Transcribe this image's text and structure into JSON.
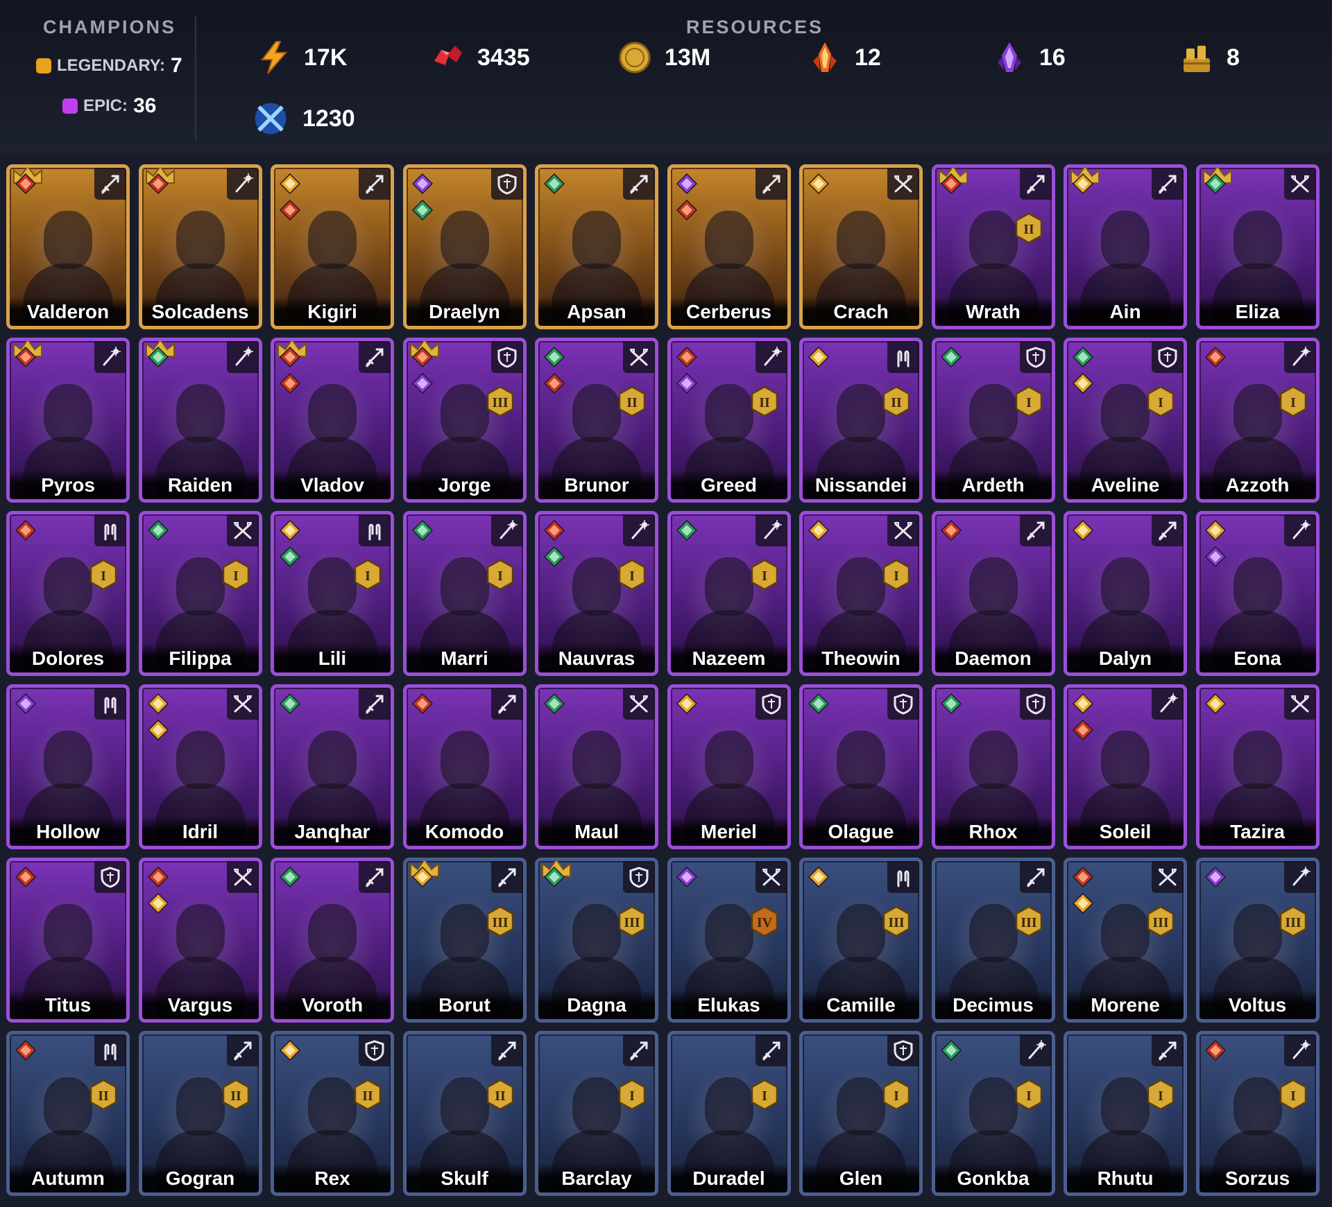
{
  "header": {
    "champions_label": "CHAMPIONS",
    "resources_label": "RESOURCES",
    "legendary": {
      "label": "LEGENDARY:",
      "value": "7",
      "color": "#e8a21c"
    },
    "epic": {
      "label": "EPIC:",
      "value": "36",
      "color": "#c23ff0"
    },
    "resources": [
      {
        "icon": "energy-icon",
        "value": "17K"
      },
      {
        "icon": "ruby-icon",
        "value": "3435"
      },
      {
        "icon": "gold-coin-icon",
        "value": "13M"
      },
      {
        "icon": "fire-shard-icon",
        "value": "12"
      },
      {
        "icon": "void-shard-icon",
        "value": "16"
      },
      {
        "icon": "treasure-icon",
        "value": "8"
      },
      {
        "icon": "arena-token-icon",
        "value": "1230"
      }
    ]
  },
  "champions": [
    {
      "name": "Valderon",
      "rarity": "legendary",
      "role": "attack",
      "affinity": "force",
      "crown": true
    },
    {
      "name": "Solcadens",
      "rarity": "legendary",
      "role": "magic",
      "affinity": "force",
      "crown": true
    },
    {
      "name": "Kigiri",
      "rarity": "legendary",
      "role": "attack",
      "affinity": "magic",
      "affinity2": "force"
    },
    {
      "name": "Draelyn",
      "rarity": "legendary",
      "role": "defense",
      "affinity": "void",
      "affinity2": "spirit"
    },
    {
      "name": "Apsan",
      "rarity": "legendary",
      "role": "attack",
      "affinity": "spirit"
    },
    {
      "name": "Cerberus",
      "rarity": "legendary",
      "role": "attack",
      "affinity": "void",
      "affinity2": "force"
    },
    {
      "name": "Crach",
      "rarity": "legendary",
      "role": "hp",
      "affinity": "magic"
    },
    {
      "name": "Wrath",
      "rarity": "epic",
      "role": "attack",
      "affinity": "force",
      "crown": true,
      "rank": "II"
    },
    {
      "name": "Ain",
      "rarity": "epic",
      "role": "attack",
      "affinity": "magic",
      "crown": true
    },
    {
      "name": "Eliza",
      "rarity": "epic",
      "role": "hp",
      "affinity": "spirit",
      "crown": true
    },
    {
      "name": "Pyros",
      "rarity": "epic",
      "role": "magic",
      "affinity": "force",
      "crown": true
    },
    {
      "name": "Raiden",
      "rarity": "epic",
      "role": "magic",
      "affinity": "spirit",
      "crown": true
    },
    {
      "name": "Vladov",
      "rarity": "epic",
      "role": "attack",
      "affinity": "force",
      "affinity2": "force",
      "crown": true
    },
    {
      "name": "Jorge",
      "rarity": "epic",
      "role": "defense",
      "affinity": "force",
      "affinity2": "void",
      "crown": true,
      "rank": "III"
    },
    {
      "name": "Brunor",
      "rarity": "epic",
      "role": "hp",
      "affinity": "spirit",
      "affinity2": "force",
      "rank": "II"
    },
    {
      "name": "Greed",
      "rarity": "epic",
      "role": "magic",
      "affinity": "force",
      "affinity2": "void",
      "rank": "II"
    },
    {
      "name": "Nissandei",
      "rarity": "epic",
      "role": "support",
      "affinity": "magic",
      "rank": "II"
    },
    {
      "name": "Ardeth",
      "rarity": "epic",
      "role": "defense",
      "affinity": "spirit",
      "rank": "I"
    },
    {
      "name": "Aveline",
      "rarity": "epic",
      "role": "defense",
      "affinity": "spirit",
      "affinity2": "magic",
      "rank": "I"
    },
    {
      "name": "Azzoth",
      "rarity": "epic",
      "role": "magic",
      "affinity": "force",
      "rank": "I"
    },
    {
      "name": "Dolores",
      "rarity": "epic",
      "role": "support",
      "affinity": "force",
      "rank": "I"
    },
    {
      "name": "Filippa",
      "rarity": "epic",
      "role": "hp",
      "affinity": "spirit",
      "rank": "I"
    },
    {
      "name": "Lili",
      "rarity": "epic",
      "role": "support",
      "affinity": "magic",
      "affinity2": "spirit",
      "rank": "I"
    },
    {
      "name": "Marri",
      "rarity": "epic",
      "role": "magic",
      "affinity": "spirit",
      "rank": "I"
    },
    {
      "name": "Nauvras",
      "rarity": "epic",
      "role": "magic",
      "affinity": "force",
      "affinity2": "spirit",
      "rank": "I"
    },
    {
      "name": "Nazeem",
      "rarity": "epic",
      "role": "magic",
      "affinity": "spirit",
      "rank": "I"
    },
    {
      "name": "Theowin",
      "rarity": "epic",
      "role": "hp",
      "affinity": "magic",
      "rank": "I"
    },
    {
      "name": "Daemon",
      "rarity": "epic",
      "role": "attack",
      "affinity": "force"
    },
    {
      "name": "Dalyn",
      "rarity": "epic",
      "role": "attack",
      "affinity": "magic"
    },
    {
      "name": "Eona",
      "rarity": "epic",
      "role": "magic",
      "affinity": "magic",
      "affinity2": "void"
    },
    {
      "name": "Hollow",
      "rarity": "epic",
      "role": "support",
      "affinity": "void"
    },
    {
      "name": "Idril",
      "rarity": "epic",
      "role": "hp",
      "affinity": "magic",
      "affinity2": "magic"
    },
    {
      "name": "Janqhar",
      "rarity": "epic",
      "role": "attack",
      "affinity": "spirit"
    },
    {
      "name": "Komodo",
      "rarity": "epic",
      "role": "attack",
      "affinity": "force"
    },
    {
      "name": "Maul",
      "rarity": "epic",
      "role": "hp",
      "affinity": "spirit"
    },
    {
      "name": "Meriel",
      "rarity": "epic",
      "role": "defense",
      "affinity": "magic"
    },
    {
      "name": "Olague",
      "rarity": "epic",
      "role": "defense",
      "affinity": "spirit"
    },
    {
      "name": "Rhox",
      "rarity": "epic",
      "role": "defense",
      "affinity": "spirit"
    },
    {
      "name": "Soleil",
      "rarity": "epic",
      "role": "magic",
      "affinity": "magic",
      "affinity2": "force"
    },
    {
      "name": "Tazira",
      "rarity": "epic",
      "role": "hp",
      "affinity": "magic"
    },
    {
      "name": "Titus",
      "rarity": "epic",
      "role": "defense",
      "affinity": "force"
    },
    {
      "name": "Vargus",
      "rarity": "epic",
      "role": "hp",
      "affinity": "force",
      "affinity2": "magic"
    },
    {
      "name": "Voroth",
      "rarity": "epic",
      "role": "attack",
      "affinity": "spirit"
    },
    {
      "name": "Borut",
      "rarity": "rare",
      "role": "attack",
      "affinity": "magic",
      "crown": true,
      "rank": "III"
    },
    {
      "name": "Dagna",
      "rarity": "rare",
      "role": "defense",
      "affinity": "spirit",
      "crown": true,
      "rank": "III"
    },
    {
      "name": "Elukas",
      "rarity": "rare",
      "role": "hp",
      "affinity": "void",
      "rank": "IV"
    },
    {
      "name": "Camille",
      "rarity": "rare",
      "role": "support",
      "affinity": "magic",
      "rank": "III"
    },
    {
      "name": "Decimus",
      "rarity": "rare",
      "role": "attack",
      "affinity": "none",
      "rank": "III"
    },
    {
      "name": "Morene",
      "rarity": "rare",
      "role": "hp",
      "affinity": "force",
      "affinity2": "magic",
      "rank": "III"
    },
    {
      "name": "Voltus",
      "rarity": "rare",
      "role": "magic",
      "affinity": "void",
      "rank": "III"
    },
    {
      "name": "Autumn",
      "rarity": "rare",
      "role": "support",
      "affinity": "force",
      "rank": "II"
    },
    {
      "name": "Gogran",
      "rarity": "rare",
      "role": "attack",
      "affinity": "none",
      "rank": "II"
    },
    {
      "name": "Rex",
      "rarity": "rare",
      "role": "defense",
      "affinity": "magic",
      "rank": "II"
    },
    {
      "name": "Skulf",
      "rarity": "rare",
      "role": "attack",
      "affinity": "none",
      "rank": "II"
    },
    {
      "name": "Barclay",
      "rarity": "rare",
      "role": "attack",
      "affinity": "none",
      "rank": "I"
    },
    {
      "name": "Duradel",
      "rarity": "rare",
      "role": "attack",
      "affinity": "none",
      "rank": "I"
    },
    {
      "name": "Glen",
      "rarity": "rare",
      "role": "defense",
      "affinity": "none",
      "rank": "I"
    },
    {
      "name": "Gonkba",
      "rarity": "rare",
      "role": "magic",
      "affinity": "spirit",
      "rank": "I"
    },
    {
      "name": "Rhutu",
      "rarity": "rare",
      "role": "attack",
      "affinity": "none",
      "rank": "I"
    },
    {
      "name": "Sorzus",
      "rarity": "rare",
      "role": "magic",
      "affinity": "force",
      "rank": "I"
    }
  ]
}
